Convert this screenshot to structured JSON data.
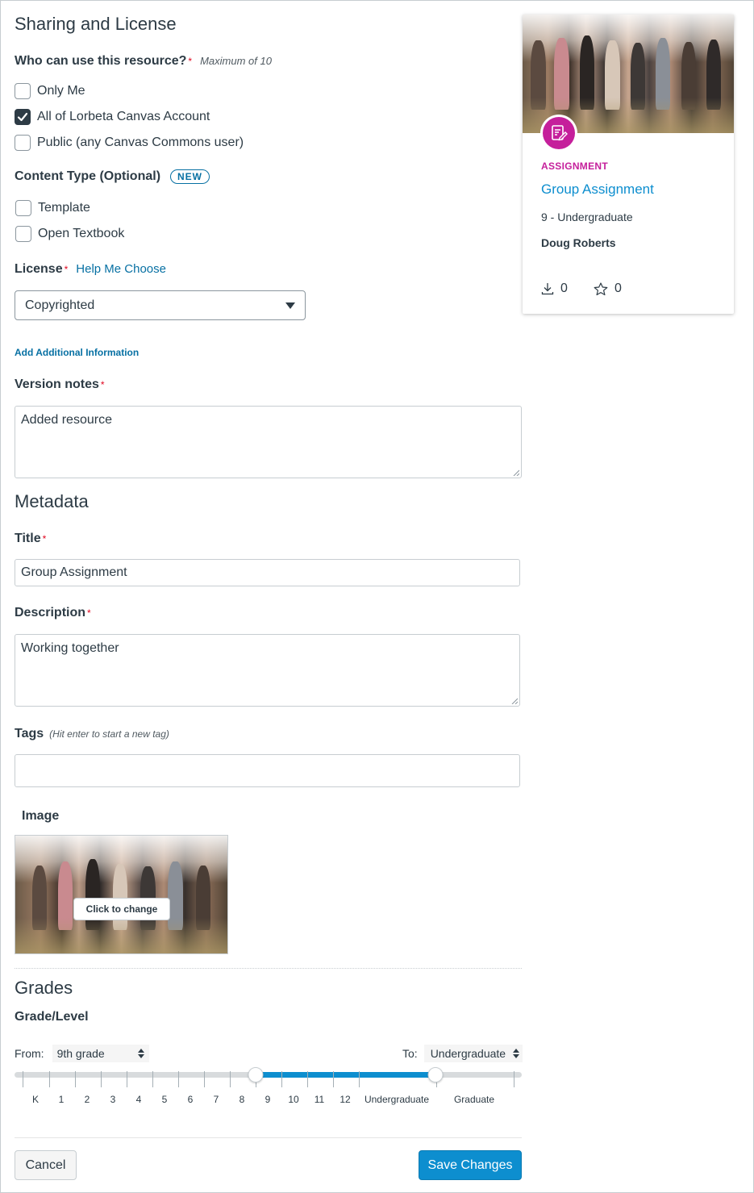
{
  "sharing": {
    "heading": "Sharing and License",
    "who_label": "Who can use this resource?",
    "required_mark": "*",
    "who_note": "Maximum of 10",
    "options": [
      {
        "label": "Only Me",
        "checked": false
      },
      {
        "label": "All of Lorbeta Canvas Account",
        "checked": true
      },
      {
        "label": "Public (any Canvas Commons user)",
        "checked": false
      }
    ],
    "content_type_label": "Content Type (Optional)",
    "content_type_badge": "NEW",
    "content_types": [
      {
        "label": "Template",
        "checked": false
      },
      {
        "label": "Open Textbook",
        "checked": false
      }
    ],
    "license_label": "License",
    "license_help": "Help Me Choose",
    "license_value": "Copyrighted",
    "add_info": "Add Additional Information",
    "version_notes_label": "Version notes",
    "version_notes_value": "Added resource"
  },
  "metadata": {
    "heading": "Metadata",
    "title_label": "Title",
    "title_value": "Group Assignment",
    "description_label": "Description",
    "description_value": "Working together",
    "tags_label": "Tags",
    "tags_hint": "(Hit enter to start a new tag)",
    "tags_value": "",
    "image_label": "Image",
    "image_button": "Click to change"
  },
  "grades": {
    "heading": "Grades",
    "level_label": "Grade/Level",
    "from_label": "From:",
    "from_value": "9th grade",
    "to_label": "To:",
    "to_value": "Undergraduate",
    "ticks": [
      "K",
      "1",
      "2",
      "3",
      "4",
      "5",
      "6",
      "7",
      "8",
      "9",
      "10",
      "11",
      "12",
      "Undergraduate",
      "Graduate"
    ],
    "range_from_index": 9,
    "range_to_index": 13
  },
  "footer": {
    "cancel": "Cancel",
    "save": "Save Changes"
  },
  "preview_card": {
    "type": "ASSIGNMENT",
    "title": "Group Assignment",
    "grade": "9 - Undergraduate",
    "author": "Doug Roberts",
    "downloads": "0",
    "favorites": "0",
    "icon": "assignment-icon",
    "type_color": "#c51f9b",
    "title_color": "#0d8ecf"
  },
  "colors": {
    "accent": "#0d8ecf",
    "link": "#0770a3",
    "required": "#e0061f",
    "primary_button": "#0d8ecf"
  }
}
